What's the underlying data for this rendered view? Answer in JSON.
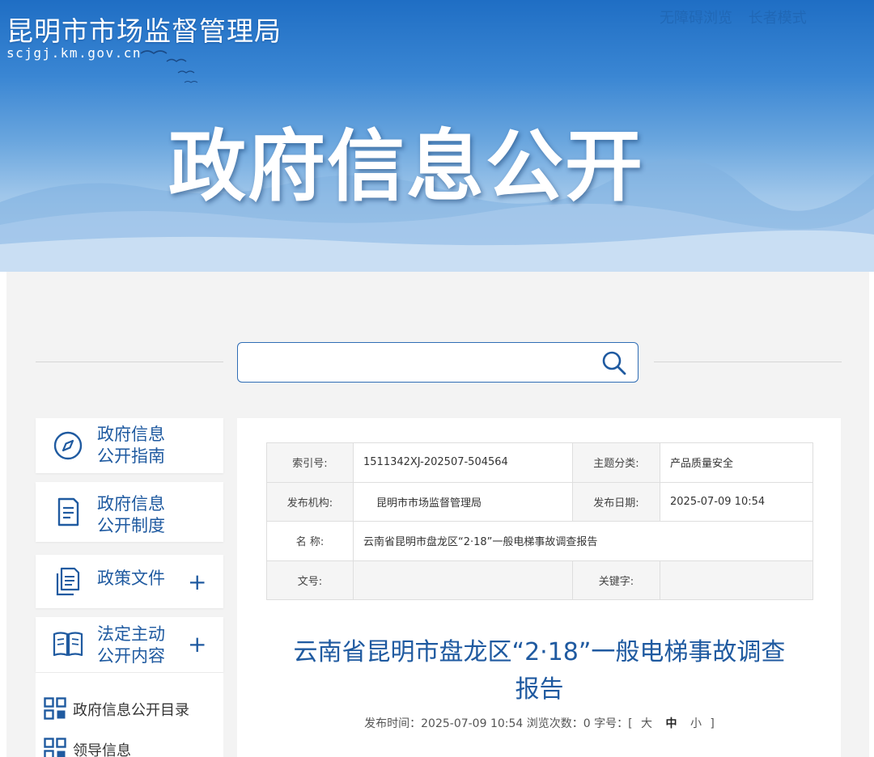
{
  "header": {
    "site_name": "昆明市市场监督管理局",
    "site_domain": "scjgj.km.gov.cn",
    "links": [
      "无障碍浏览",
      "长者模式"
    ],
    "banner_title": "政府信息公开"
  },
  "search": {
    "placeholder": "",
    "value": ""
  },
  "sidebar": {
    "items": [
      {
        "label_line1": "政府信息",
        "label_line2": "公开指南",
        "icon": "compass-icon"
      },
      {
        "label_line1": "政府信息",
        "label_line2": "公开制度",
        "icon": "document-icon"
      },
      {
        "label": "政策文件",
        "icon": "files-icon",
        "expand": "+"
      },
      {
        "label_line1": "法定主动",
        "label_line2": "公开内容",
        "icon": "book-icon",
        "expand": "+"
      }
    ],
    "sub_items": [
      {
        "label": "政府信息公开目录",
        "icon": "grid-icon"
      },
      {
        "label": "领导信息",
        "icon": "grid-icon"
      }
    ]
  },
  "meta": {
    "index_label": "索引号:",
    "index_value": "1511342XJ-202507-504564",
    "topic_label": "主题分类:",
    "topic_value": "产品质量安全",
    "org_label": "发布机构:",
    "org_value": "昆明市市场监督管理局",
    "date_label": "发布日期:",
    "date_value": "2025-07-09 10:54",
    "name_label": "名 称:",
    "name_value": "云南省昆明市盘龙区“2·18”一般电梯事故调查报告",
    "docno_label": "文号:",
    "docno_value": "",
    "keyword_label": "关键字:",
    "keyword_value": ""
  },
  "article": {
    "title_line1": "云南省昆明市盘龙区“2·18”一般电梯事故调查",
    "title_line2": "报告",
    "publish_prefix": "发布时间：2025-07-09 10:54 浏览次数：0 字号：[",
    "font_large": "大",
    "font_medium": "中",
    "font_small": "小",
    "font_suffix": "]"
  },
  "colors": {
    "brand_blue": "#1f5aa0",
    "banner_top": "#1f6ec4",
    "panel_bg": "#f3f3f3"
  }
}
